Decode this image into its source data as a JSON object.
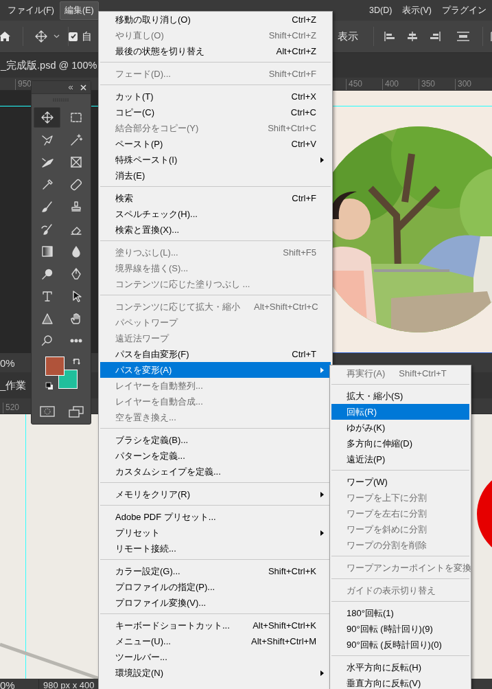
{
  "menubar": [
    {
      "label": "ファイル(F)",
      "selected": false
    },
    {
      "label": "編集(E)",
      "selected": true
    },
    {
      "label": "3D(D)",
      "selected": false
    },
    {
      "label": "表示(V)",
      "selected": false
    },
    {
      "label": "プラグイン",
      "selected": false
    }
  ],
  "options_bar": {
    "auto_select": {
      "label": "自",
      "checked": true
    },
    "show_label": "表示"
  },
  "documents": [
    {
      "tab": "_完成版.psd @ 100%",
      "ruler": [
        "950",
        "450",
        "400",
        "350",
        "300"
      ],
      "zoom": "0%"
    },
    {
      "tab": "_作業",
      "ruler": [
        "520"
      ],
      "zoom": "0%",
      "size": "980 px x 400"
    }
  ],
  "tools": [
    {
      "selected": true
    },
    {
      "selected": false
    },
    {
      "selected": false
    },
    {
      "selected": false
    },
    {
      "selected": false
    },
    {
      "selected": false
    },
    {
      "selected": false
    },
    {
      "selected": false
    },
    {
      "selected": false
    },
    {
      "selected": false
    },
    {
      "selected": false
    },
    {
      "selected": false
    },
    {
      "selected": false
    },
    {
      "selected": false
    },
    {
      "selected": false
    },
    {
      "selected": false
    },
    {
      "selected": false
    },
    {
      "selected": false
    },
    {
      "selected": false
    },
    {
      "selected": false
    },
    {
      "selected": false
    },
    {
      "selected": false
    }
  ],
  "swatches": [
    {
      "color": "#b0533a"
    },
    {
      "color": "#20bf9c"
    }
  ],
  "menu": {
    "items": [
      {
        "kind": "item",
        "label": "移動の取り消し(O)",
        "shortcut": "Ctrl+Z",
        "disabled": false,
        "selected": false,
        "has_submenu": false
      },
      {
        "kind": "item",
        "label": "やり直し(O)",
        "shortcut": "Shift+Ctrl+Z",
        "disabled": true,
        "selected": false,
        "has_submenu": false
      },
      {
        "kind": "item",
        "label": "最後の状態を切り替え",
        "shortcut": "Alt+Ctrl+Z",
        "disabled": false,
        "selected": false,
        "has_submenu": false
      },
      {
        "kind": "separator"
      },
      {
        "kind": "item",
        "label": "フェード(D)...",
        "shortcut": "Shift+Ctrl+F",
        "disabled": true,
        "selected": false,
        "has_submenu": false
      },
      {
        "kind": "separator"
      },
      {
        "kind": "item",
        "label": "カット(T)",
        "shortcut": "Ctrl+X",
        "disabled": false,
        "selected": false,
        "has_submenu": false
      },
      {
        "kind": "item",
        "label": "コピー(C)",
        "shortcut": "Ctrl+C",
        "disabled": false,
        "selected": false,
        "has_submenu": false
      },
      {
        "kind": "item",
        "label": "結合部分をコピー(Y)",
        "shortcut": "Shift+Ctrl+C",
        "disabled": true,
        "selected": false,
        "has_submenu": false
      },
      {
        "kind": "item",
        "label": "ペースト(P)",
        "shortcut": "Ctrl+V",
        "disabled": false,
        "selected": false,
        "has_submenu": false
      },
      {
        "kind": "item",
        "label": "特殊ペースト(I)",
        "disabled": false,
        "selected": false,
        "has_submenu": true
      },
      {
        "kind": "item",
        "label": "消去(E)",
        "disabled": false,
        "selected": false,
        "has_submenu": false
      },
      {
        "kind": "separator"
      },
      {
        "kind": "item",
        "label": "検索",
        "shortcut": "Ctrl+F",
        "disabled": false,
        "selected": false,
        "has_submenu": false
      },
      {
        "kind": "item",
        "label": "スペルチェック(H)...",
        "disabled": false,
        "selected": false,
        "has_submenu": false
      },
      {
        "kind": "item",
        "label": "検索と置換(X)...",
        "disabled": false,
        "selected": false,
        "has_submenu": false
      },
      {
        "kind": "separator"
      },
      {
        "kind": "item",
        "label": "塗りつぶし(L)...",
        "shortcut": "Shift+F5",
        "disabled": true,
        "selected": false,
        "has_submenu": false
      },
      {
        "kind": "item",
        "label": "境界線を描く(S)...",
        "disabled": true,
        "selected": false,
        "has_submenu": false
      },
      {
        "kind": "item",
        "label": "コンテンツに応じた塗りつぶし ...",
        "disabled": true,
        "selected": false,
        "has_submenu": false
      },
      {
        "kind": "separator"
      },
      {
        "kind": "item",
        "label": "コンテンツに応じて拡大・縮小",
        "shortcut": "Alt+Shift+Ctrl+C",
        "disabled": true,
        "selected": false,
        "has_submenu": false
      },
      {
        "kind": "item",
        "label": "パペットワープ",
        "disabled": true,
        "selected": false,
        "has_submenu": false
      },
      {
        "kind": "item",
        "label": "遠近法ワープ",
        "disabled": true,
        "selected": false,
        "has_submenu": false
      },
      {
        "kind": "item",
        "label": "パスを自由変形(F)",
        "shortcut": "Ctrl+T",
        "disabled": false,
        "selected": false,
        "has_submenu": false
      },
      {
        "kind": "item",
        "label": "パスを変形(A)",
        "disabled": false,
        "selected": true,
        "has_submenu": true
      },
      {
        "kind": "item",
        "label": "レイヤーを自動整列...",
        "disabled": true,
        "selected": false,
        "has_submenu": false
      },
      {
        "kind": "item",
        "label": "レイヤーを自動合成...",
        "disabled": true,
        "selected": false,
        "has_submenu": false
      },
      {
        "kind": "item",
        "label": "空を置き換え...",
        "disabled": true,
        "selected": false,
        "has_submenu": false
      },
      {
        "kind": "separator"
      },
      {
        "kind": "item",
        "label": "ブラシを定義(B)...",
        "disabled": false,
        "selected": false,
        "has_submenu": false
      },
      {
        "kind": "item",
        "label": "パターンを定義...",
        "disabled": false,
        "selected": false,
        "has_submenu": false
      },
      {
        "kind": "item",
        "label": "カスタムシェイプを定義...",
        "disabled": false,
        "selected": false,
        "has_submenu": false
      },
      {
        "kind": "separator"
      },
      {
        "kind": "item",
        "label": "メモリをクリア(R)",
        "disabled": false,
        "selected": false,
        "has_submenu": true
      },
      {
        "kind": "separator"
      },
      {
        "kind": "item",
        "label": "Adobe PDF プリセット...",
        "disabled": false,
        "selected": false,
        "has_submenu": false
      },
      {
        "kind": "item",
        "label": "プリセット",
        "disabled": false,
        "selected": false,
        "has_submenu": true
      },
      {
        "kind": "item",
        "label": "リモート接続...",
        "disabled": false,
        "selected": false,
        "has_submenu": false
      },
      {
        "kind": "separator"
      },
      {
        "kind": "item",
        "label": "カラー設定(G)...",
        "shortcut": "Shift+Ctrl+K",
        "disabled": false,
        "selected": false,
        "has_submenu": false
      },
      {
        "kind": "item",
        "label": "プロファイルの指定(P)...",
        "disabled": false,
        "selected": false,
        "has_submenu": false
      },
      {
        "kind": "item",
        "label": "プロファイル変換(V)...",
        "disabled": false,
        "selected": false,
        "has_submenu": false
      },
      {
        "kind": "separator"
      },
      {
        "kind": "item",
        "label": "キーボードショートカット...",
        "shortcut": "Alt+Shift+Ctrl+K",
        "disabled": false,
        "selected": false,
        "has_submenu": false
      },
      {
        "kind": "item",
        "label": "メニュー(U)...",
        "shortcut": "Alt+Shift+Ctrl+M",
        "disabled": false,
        "selected": false,
        "has_submenu": false
      },
      {
        "kind": "item",
        "label": "ツールバー...",
        "disabled": false,
        "selected": false,
        "has_submenu": false
      },
      {
        "kind": "item",
        "label": "環境設定(N)",
        "disabled": false,
        "selected": false,
        "has_submenu": true
      }
    ]
  },
  "submenu": {
    "items": [
      {
        "kind": "item",
        "label": "再実行(A)",
        "shortcut": "Shift+Ctrl+T",
        "disabled": true,
        "selected": false
      },
      {
        "kind": "separator"
      },
      {
        "kind": "item",
        "label": "拡大・縮小(S)",
        "disabled": false,
        "selected": false
      },
      {
        "kind": "item",
        "label": "回転(R)",
        "disabled": false,
        "selected": true
      },
      {
        "kind": "item",
        "label": "ゆがみ(K)",
        "disabled": false,
        "selected": false
      },
      {
        "kind": "item",
        "label": "多方向に伸縮(D)",
        "disabled": false,
        "selected": false
      },
      {
        "kind": "item",
        "label": "遠近法(P)",
        "disabled": false,
        "selected": false
      },
      {
        "kind": "separator"
      },
      {
        "kind": "item",
        "label": "ワープ(W)",
        "disabled": false,
        "selected": false
      },
      {
        "kind": "item",
        "label": "ワープを上下に分割",
        "disabled": true,
        "selected": false
      },
      {
        "kind": "item",
        "label": "ワープを左右に分割",
        "disabled": true,
        "selected": false
      },
      {
        "kind": "item",
        "label": "ワープを斜めに分割",
        "disabled": true,
        "selected": false
      },
      {
        "kind": "item",
        "label": "ワープの分割を削除",
        "disabled": true,
        "selected": false
      },
      {
        "kind": "separator"
      },
      {
        "kind": "item",
        "label": "ワープアンカーポイントを変換",
        "disabled": true,
        "selected": false
      },
      {
        "kind": "separator"
      },
      {
        "kind": "item",
        "label": "ガイドの表示切り替え",
        "disabled": true,
        "selected": false
      },
      {
        "kind": "separator"
      },
      {
        "kind": "item",
        "label": "180°回転(1)",
        "disabled": false,
        "selected": false
      },
      {
        "kind": "item",
        "label": "90°回転 (時計回り)(9)",
        "disabled": false,
        "selected": false
      },
      {
        "kind": "item",
        "label": "90°回転 (反時計回り)(0)",
        "disabled": false,
        "selected": false
      },
      {
        "kind": "separator"
      },
      {
        "kind": "item",
        "label": "水平方向に反転(H)",
        "disabled": false,
        "selected": false
      },
      {
        "kind": "item",
        "label": "垂直方向に反転(V)",
        "disabled": false,
        "selected": false
      }
    ]
  }
}
